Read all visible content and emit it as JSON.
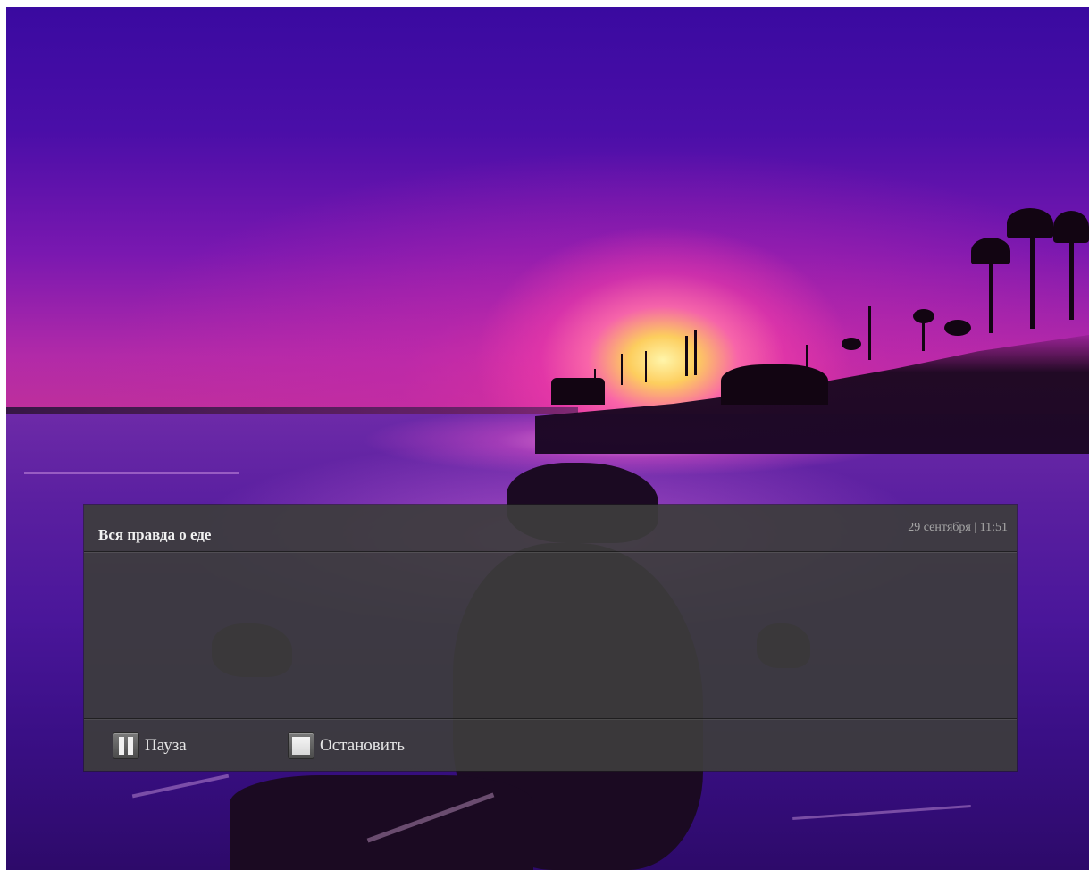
{
  "background": {
    "icon": "sunset-beach-wallpaper",
    "accent_colors": [
      "#4a0ea8",
      "#c0309a",
      "#ffd65a"
    ]
  },
  "notification": {
    "title": "Вся правда о еде",
    "meta": "29 сентября | 11:51",
    "body": "",
    "background_color": "#3c3c3c"
  },
  "controls": {
    "pause": {
      "label": "Пауза",
      "icon": "pause-icon"
    },
    "stop": {
      "label": "Остановить",
      "icon": "stop-icon"
    }
  }
}
